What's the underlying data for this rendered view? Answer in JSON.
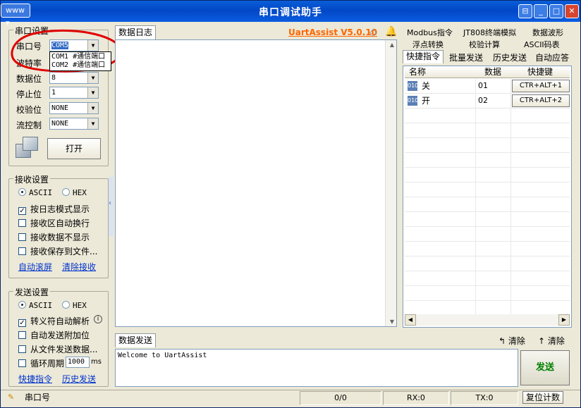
{
  "window": {
    "title": "串口调试助手",
    "sys_menu": "www"
  },
  "serial": {
    "group_title": "串口设置",
    "port_label": "串口号",
    "port_value": "COM5",
    "port_options": [
      "COM1 #通信端口",
      "COM2 #通信端口"
    ],
    "baud_label": "波特率",
    "databits_label": "数据位",
    "databits_value": "8",
    "stopbits_label": "停止位",
    "stopbits_value": "1",
    "parity_label": "校验位",
    "parity_value": "NONE",
    "flow_label": "流控制",
    "flow_value": "NONE",
    "open_label": "打开"
  },
  "receive": {
    "group_title": "接收设置",
    "ascii": "ASCII",
    "hex": "HEX",
    "opts": [
      "按日志模式显示",
      "接收区自动换行",
      "接收数据不显示",
      "接收保存到文件..."
    ],
    "auto_scroll": "自动滚屏",
    "clear": "清除接收"
  },
  "send": {
    "group_title": "发送设置",
    "ascii": "ASCII",
    "hex": "HEX",
    "opts": [
      "转义符自动解析",
      "自动发送附加位",
      "从文件发送数据...",
      "循环周期"
    ],
    "period": "1000",
    "unit": "ms",
    "quick_cmd": "快捷指令",
    "history": "历史发送"
  },
  "log": {
    "tab": "数据日志",
    "brand": "UartAssist V5.0.10"
  },
  "sendbox": {
    "tab": "数据发送",
    "clear1": "清除",
    "clear2": "清除",
    "text": "Welcome to UartAssist",
    "send_label": "发送"
  },
  "right": {
    "tabs_row1": [
      "Modbus指令",
      "JT808终端模拟",
      "数据波形"
    ],
    "tabs_row2": [
      "浮点转换",
      "校验计算",
      "ASCII码表"
    ],
    "tabs_row3": [
      "快捷指令",
      "批量发送",
      "历史发送",
      "自动应答"
    ],
    "headers": [
      "名称",
      "数据",
      "快捷键"
    ],
    "rows": [
      {
        "name": "关",
        "data": "01",
        "key": "CTR+ALT+1"
      },
      {
        "name": "开",
        "data": "02",
        "key": "CTR+ALT+2"
      }
    ]
  },
  "statusbar": {
    "port": "串口号",
    "count": "0/0",
    "rx": "RX:0",
    "tx": "TX:0",
    "reset": "复位计数"
  },
  "colors": {
    "title_bar": "#0247c6",
    "brand": "#ff6600",
    "send_btn": "#008000",
    "annotation": "#e00000"
  }
}
